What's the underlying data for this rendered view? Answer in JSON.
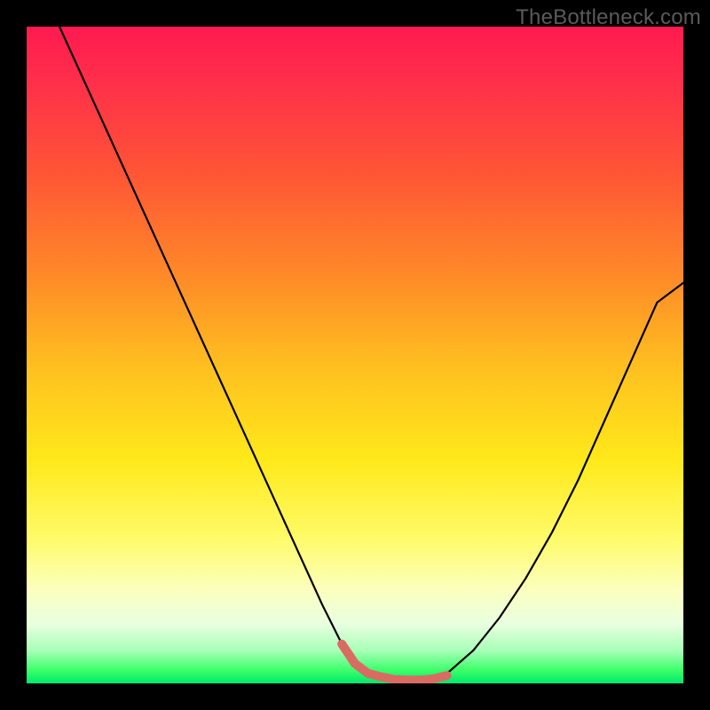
{
  "watermark": {
    "text": "TheBottleneck.com"
  },
  "chart_data": {
    "type": "line",
    "title": "",
    "xlabel": "",
    "ylabel": "",
    "xlim": [
      0,
      100
    ],
    "ylim": [
      0,
      100
    ],
    "series": [
      {
        "name": "left-curve",
        "x": [
          5,
          10,
          15,
          20,
          25,
          30,
          35,
          40,
          45,
          48,
          50,
          52,
          54
        ],
        "y": [
          100,
          89,
          78,
          67,
          56,
          45,
          34,
          23,
          12,
          6,
          3,
          1.5,
          1
        ]
      },
      {
        "name": "floor-segment",
        "x": [
          54,
          56,
          58,
          60,
          62,
          64
        ],
        "y": [
          1,
          0.6,
          0.5,
          0.5,
          0.7,
          1.2
        ]
      },
      {
        "name": "right-curve",
        "x": [
          64,
          68,
          72,
          76,
          80,
          84,
          88,
          92,
          96,
          100
        ],
        "y": [
          1.5,
          5,
          10,
          16,
          23,
          31,
          40,
          49,
          58,
          61
        ]
      }
    ],
    "highlight": {
      "name": "valley-marker",
      "x": [
        48,
        50,
        52,
        54,
        56,
        58,
        60,
        62,
        64
      ],
      "y": [
        6,
        3,
        1.5,
        1,
        0.6,
        0.5,
        0.5,
        0.7,
        1.2
      ],
      "color": "#d96b63"
    }
  }
}
